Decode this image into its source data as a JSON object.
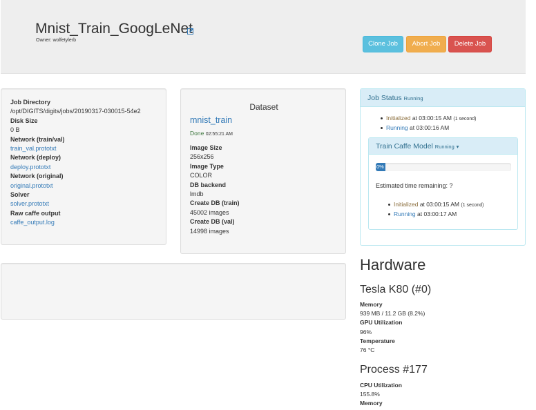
{
  "header": {
    "job_title": "Mnist_Train_GoogLeNet",
    "owner": "Owner: wolfetylerb",
    "buttons": {
      "clone": "Clone Job",
      "abort": "Abort Job",
      "delete": "Delete Job"
    }
  },
  "job_info": [
    {
      "label": "Job Directory",
      "value": "/opt/DIGITS/digits/jobs/20190317-030015-54e2",
      "link": false
    },
    {
      "label": "Disk Size",
      "value": "0 B",
      "link": false
    },
    {
      "label": "Network (train/val)",
      "value": "train_val.prototxt",
      "link": true
    },
    {
      "label": "Network (deploy)",
      "value": "deploy.prototxt",
      "link": true
    },
    {
      "label": "Network (original)",
      "value": "original.prototxt",
      "link": true
    },
    {
      "label": "Solver",
      "value": "solver.prototxt",
      "link": true
    },
    {
      "label": "Raw caffe output",
      "value": "caffe_output.log",
      "link": true
    }
  ],
  "dataset": {
    "title": "Dataset",
    "name": "mnist_train",
    "status": "Done",
    "status_time": "02:55:21 AM",
    "fields": [
      {
        "label": "Image Size",
        "value": "256x256"
      },
      {
        "label": "Image Type",
        "value": "COLOR"
      },
      {
        "label": "DB backend",
        "value": "lmdb"
      },
      {
        "label": "Create DB (train)",
        "value": "45002 images"
      },
      {
        "label": "Create DB (val)",
        "value": "14998 images"
      }
    ]
  },
  "job_status": {
    "title": "Job Status",
    "state": "Running",
    "events": [
      {
        "state": "Initialized",
        "text": "at 03:00:15 AM",
        "note": "(1 second)",
        "color": "#8a6d3b"
      },
      {
        "state": "Running",
        "text": "at 03:00:16 AM",
        "note": "",
        "color": "#337ab7"
      }
    ]
  },
  "train_task": {
    "title": "Train Caffe Model",
    "state": "Running",
    "caret": "▾",
    "progress_percent": 0,
    "progress_label": "0%",
    "eta": "Estimated time remaining: ?",
    "events": [
      {
        "state": "Initialized",
        "text": "at 03:00:15 AM",
        "note": "(1 second)"
      },
      {
        "state": "Running",
        "text": "at 03:00:17 AM",
        "note": ""
      }
    ]
  },
  "hardware": {
    "title": "Hardware",
    "gpu_name": "Tesla K80 (#0)",
    "gpu_stats": [
      {
        "label": "Memory",
        "value": "939 MB / 11.2 GB (8.2%)"
      },
      {
        "label": "GPU Utilization",
        "value": "96%"
      },
      {
        "label": "Temperature",
        "value": "76 °C"
      }
    ],
    "process_name": "Process #177",
    "process_stats": [
      {
        "label": "CPU Utilization",
        "value": "155.8%"
      },
      {
        "label": "Memory",
        "value": ""
      }
    ]
  },
  "colors": {
    "link": "#337ab7",
    "clone": "#5bc0de",
    "abort": "#f0ad4e",
    "delete": "#d9534f",
    "panel_head": "#d9edf7",
    "done": "#3c763d"
  }
}
